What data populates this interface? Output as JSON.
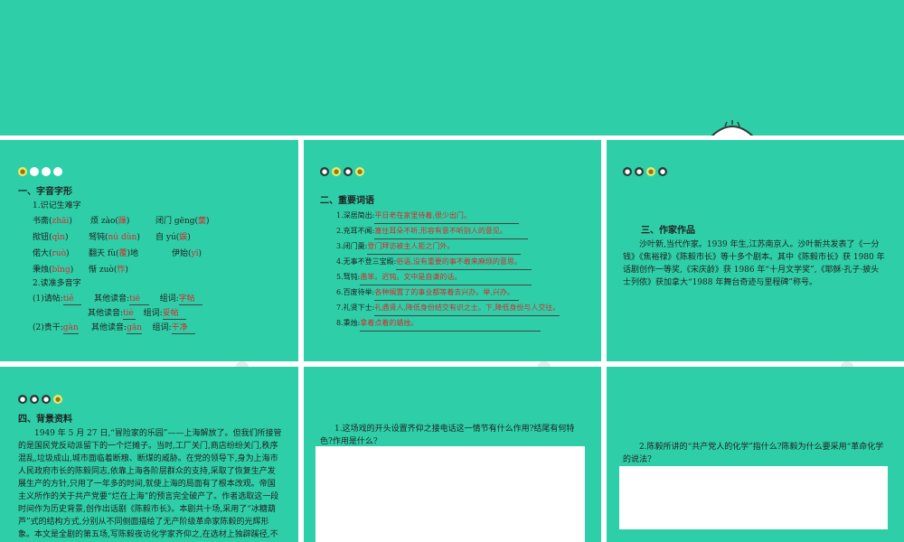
{
  "nav_dots": {
    "p1": [
      "",
      "",
      "",
      ""
    ],
    "p2": [
      "",
      "",
      "",
      ""
    ],
    "p3": [
      "",
      "",
      "",
      ""
    ],
    "p4": [
      "",
      "",
      "",
      ""
    ]
  },
  "p1": {
    "section": "一、字音字形",
    "sub1": "1.识记生难字",
    "rows": [
      [
        {
          "pre": "书斋(",
          "ans": "zhāi",
          "post": ")"
        },
        {
          "pre": "烦 zào(",
          "ans": "躁",
          "post": ")"
        },
        {
          "pre": "闭门 gēng(",
          "ans": "羹",
          "post": ")"
        }
      ],
      [
        {
          "pre": "揿钮(",
          "ans": "qìn",
          "post": ")"
        },
        {
          "pre": "驽钝(",
          "ans": "nú dùn",
          "post": ")"
        },
        {
          "pre": "自 yú(",
          "ans": "娱",
          "post": ")"
        }
      ],
      [
        {
          "pre": "偌大(",
          "ans": "ruò",
          "post": ")"
        },
        {
          "pre": "翻天 fù(",
          "ans": "覆",
          "post": ")地"
        },
        {
          "pre": "伊始(",
          "ans": "yī",
          "post": ")"
        }
      ],
      [
        {
          "pre": "秉烛(",
          "ans": "bǐng",
          "post": ")"
        },
        {
          "pre": "惭 zuò(",
          "ans": "怍",
          "post": ")"
        }
      ]
    ],
    "sub2": "2.读准多音字",
    "poly1_label": "(1)请帖:",
    "poly1_a": "tiě",
    "poly1_other1_label": "其他读音:",
    "poly1_other1": "tiē",
    "poly1_word1_label": "组词:",
    "poly1_word1": "字帖",
    "poly1_other2_label": "其他读音:",
    "poly1_other2": "tiè",
    "poly1_word2_label": "组词:",
    "poly1_word2": "妥帖",
    "poly2_label": "(2)贵干:",
    "poly2_a": "gàn",
    "poly2_other_label": "其他读音:",
    "poly2_other": "gān",
    "poly2_word_label": "组词:",
    "poly2_word": "干净"
  },
  "p2": {
    "section": "二、重要词语",
    "items": [
      {
        "term": "1.深居简出:",
        "def": "平日老在家里待着,很少出门。"
      },
      {
        "term": "2.充耳不闻:",
        "def": "塞住耳朵不听,形容有意不听别人的意见。"
      },
      {
        "term": "3.闭门羹:",
        "def": "登门拜访被主人拒之门外。"
      },
      {
        "term": "4.无事不登三宝殿:",
        "def": "俗语,没有重要的事不敢来麻烦的意思。"
      },
      {
        "term": "5.驽钝:",
        "def": "愚笨。迟钝。文中是自谦的话。"
      },
      {
        "term": "6.百废待举:",
        "def": "各种搁置了的事业都等着去兴办。举,兴办。"
      },
      {
        "term": "7.礼贤下士:",
        "def": "礼遇贤人,降低身份结交有识之士。下,降低身份与人交往。"
      },
      {
        "term": "8.秉烛:",
        "def": "拿着点着的蜡烛。"
      }
    ]
  },
  "p3": {
    "section": "三、作家作品",
    "body": "沙叶新,当代作家。1939 年生,江苏南京人。沙叶新共发表了《一分钱》《焦裕禄》《陈毅市长》等十多个剧本。其中《陈毅市长》获 1980 年话剧创作一等奖,《宋庆龄》获 1986 年“十月文学奖”,《耶稣·孔子·披头士列侬》获加拿大“1988 年舞台奇迹与里程碑”称号。"
  },
  "p4": {
    "section": "四、背景资料",
    "body": "1949 年 5 月 27 日,“冒险家的乐园”——上海解放了。但我们所接管的是国民党反动派留下的一个烂摊子。当时,工厂关门,商店纷纷关门,秩序混乱,垃圾成山,城市面临着断粮、断煤的威胁。在党的领导下,身为上海市人民政府市长的陈毅同志,依靠上海各阶层群众的支持,采取了恢复生产发展生产的方针,只用了一年多的时间,就使上海的局面有了根本改观。帝国主义所作的关于共产党要“烂在上海”的预言完全破产了。作者选取这一段时间作为历史背景,创作出话剧《陈毅市长》。本剧共十场,采用了“冰糖葫芦”式的结构方式,分别从不同侧面描绘了无产阶级革命家陈毅的光辉形象。本文是全剧的第五场,写陈毅夜访化学家齐仰之,在选材上独辟蹊径,不"
  },
  "p5": {
    "question": "1.这场戏的开头设置齐仰之接电话这一情节有什么作用?结尾有何特色?作用是什么?"
  },
  "p6": {
    "question": "2.陈毅所讲的“共产党人的化学”指什么?陈毅为什么要采用“革命化学的说法?"
  },
  "colors": {
    "accent": "#2ecfa8",
    "answer": "#d42a2a",
    "dot_yellow": "#f3e66a"
  }
}
